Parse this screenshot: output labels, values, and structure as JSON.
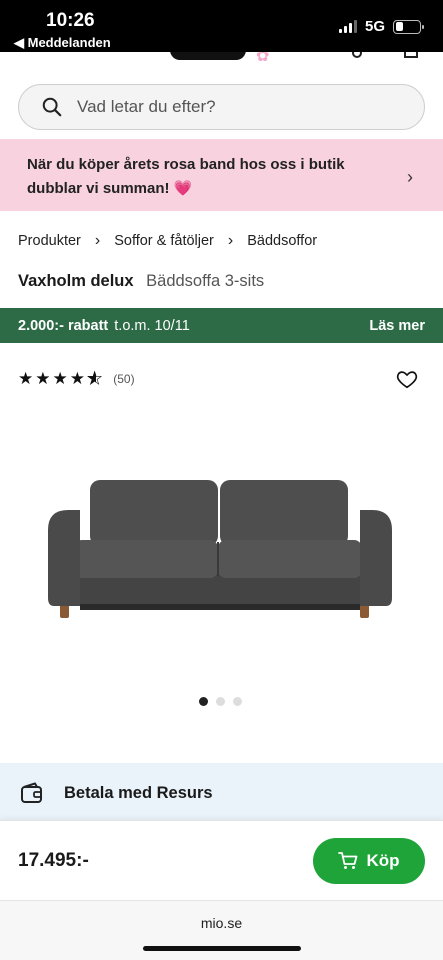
{
  "status_bar": {
    "time": "10:26",
    "back_label": "◀ Meddelanden",
    "network": "5G"
  },
  "search": {
    "placeholder": "Vad letar du efter?"
  },
  "promo": {
    "text": "När du köper årets rosa band hos oss i butik dubblar vi summan! 💗"
  },
  "breadcrumb": {
    "items": [
      "Produkter",
      "Soffor & fåtöljer",
      "Bäddsoffor"
    ]
  },
  "product": {
    "name": "Vaxholm delux",
    "subtitle": "Bäddsoffa 3-sits",
    "rating": 4.5,
    "review_count": "(50)",
    "image_count": 3,
    "active_image": 1
  },
  "discount": {
    "amount": "2.000:- rabatt",
    "until": "t.o.m. 10/11",
    "more_label": "Läs mer"
  },
  "payment": {
    "label": "Betala med Resurs"
  },
  "buy_bar": {
    "price": "17.495:-",
    "button_label": "Köp"
  },
  "browser": {
    "url": "mio.se"
  },
  "colors": {
    "promo_bg": "#f9d2df",
    "discount_bg": "#2d6b47",
    "buy_button": "#1fa43a",
    "resurs_bg": "#eaf3fa"
  }
}
